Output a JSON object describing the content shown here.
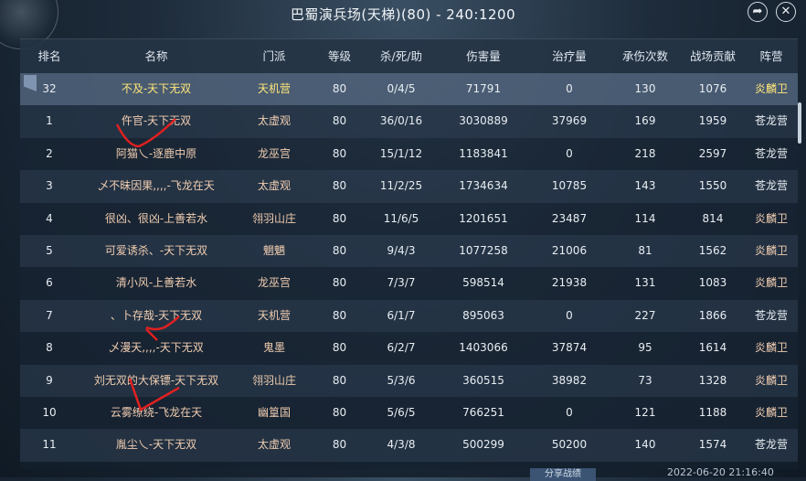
{
  "header": {
    "title": "巴蜀演兵场(天梯)(80) - 240:1200"
  },
  "columns": [
    "排名",
    "名称",
    "门派",
    "等级",
    "杀/死/助",
    "伤害量",
    "治疗量",
    "承伤次数",
    "战场贡献",
    "阵营"
  ],
  "rows": [
    {
      "rank": "32",
      "name": "不及-天下无双",
      "school": "天机营",
      "level": "80",
      "kda": "0/4/5",
      "damage": "71791",
      "heal": "0",
      "tank": "130",
      "contrib": "1076",
      "camp": "炎麟卫",
      "campType": "lin",
      "self": true
    },
    {
      "rank": "1",
      "name": "仵官-天下无双",
      "school": "太虚观",
      "level": "80",
      "kda": "36/0/16",
      "damage": "3030889",
      "heal": "37969",
      "tank": "169",
      "contrib": "1959",
      "camp": "苍龙营",
      "campType": "cang"
    },
    {
      "rank": "2",
      "name": "阿猫乀-逐鹿中原",
      "school": "龙巫宫",
      "level": "80",
      "kda": "15/1/12",
      "damage": "1183841",
      "heal": "0",
      "tank": "218",
      "contrib": "2597",
      "camp": "苍龙营",
      "campType": "cang"
    },
    {
      "rank": "3",
      "name": "乄不昧因果,,,,-飞龙在天",
      "school": "太虚观",
      "level": "80",
      "kda": "11/2/25",
      "damage": "1734634",
      "heal": "10785",
      "tank": "143",
      "contrib": "1550",
      "camp": "苍龙营",
      "campType": "cang"
    },
    {
      "rank": "4",
      "name": "很凶、很凶-上善若水",
      "school": "翎羽山庄",
      "level": "80",
      "kda": "11/6/5",
      "damage": "1201651",
      "heal": "23487",
      "tank": "114",
      "contrib": "814",
      "camp": "炎麟卫",
      "campType": "lin"
    },
    {
      "rank": "5",
      "name": "可爱诱杀、-天下无双",
      "school": "魍魉",
      "level": "80",
      "kda": "9/4/3",
      "damage": "1077258",
      "heal": "21006",
      "tank": "81",
      "contrib": "1562",
      "camp": "炎麟卫",
      "campType": "lin"
    },
    {
      "rank": "6",
      "name": "清小风-上善若水",
      "school": "龙巫宫",
      "level": "80",
      "kda": "7/3/7",
      "damage": "598514",
      "heal": "21938",
      "tank": "131",
      "contrib": "1083",
      "camp": "炎麟卫",
      "campType": "lin"
    },
    {
      "rank": "7",
      "name": "、卜存哉-天下无双",
      "school": "天机营",
      "level": "80",
      "kda": "6/1/7",
      "damage": "895063",
      "heal": "0",
      "tank": "227",
      "contrib": "1866",
      "camp": "苍龙营",
      "campType": "cang"
    },
    {
      "rank": "8",
      "name": "乄漫天,,,,-天下无双",
      "school": "鬼墨",
      "level": "80",
      "kda": "6/2/7",
      "damage": "1403066",
      "heal": "37874",
      "tank": "95",
      "contrib": "1614",
      "camp": "炎麟卫",
      "campType": "lin"
    },
    {
      "rank": "9",
      "name": "刘无双的大保镖-天下无双",
      "school": "翎羽山庄",
      "level": "80",
      "kda": "5/3/6",
      "damage": "360515",
      "heal": "38982",
      "tank": "73",
      "contrib": "1328",
      "camp": "炎麟卫",
      "campType": "lin"
    },
    {
      "rank": "10",
      "name": "云雾缭绕-飞龙在天",
      "school": "幽篁国",
      "level": "80",
      "kda": "5/6/5",
      "damage": "766251",
      "heal": "0",
      "tank": "121",
      "contrib": "1188",
      "camp": "炎麟卫",
      "campType": "lin"
    },
    {
      "rank": "11",
      "name": "胤尘乀-天下无双",
      "school": "太虚观",
      "level": "80",
      "kda": "4/3/8",
      "damage": "500299",
      "heal": "50200",
      "tank": "140",
      "contrib": "1574",
      "camp": "苍龙营",
      "campType": "cang"
    }
  ],
  "footer": {
    "button_label": "分享战绩",
    "timestamp": "2022-06-20 21:16:40"
  },
  "icons": {
    "share": "share-icon",
    "close": "close-icon"
  },
  "colors": {
    "highlight_row_text": "#ffe67a",
    "lin_camp_text": "#f0cdb1",
    "annotation_red": "#e02020"
  }
}
